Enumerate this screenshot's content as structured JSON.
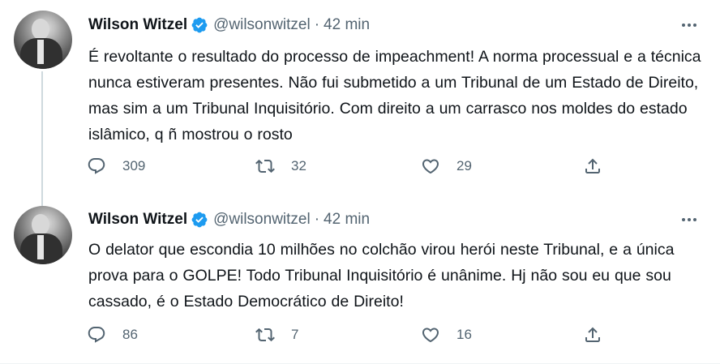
{
  "tweets": [
    {
      "author_name": "Wilson Witzel",
      "handle": "@wilsonwitzel",
      "separator": "·",
      "time": "42 min",
      "text": "É revoltante o resultado do processo de impeachment! A norma processual e a técnica nunca estiveram presentes. Não fui submetido a um Tribunal de um Estado de Direito, mas sim a um Tribunal Inquisitório. Com direito a um carrasco nos moldes do estado islâmico, q ñ mostrou o rosto",
      "replies": "309",
      "retweets": "32",
      "likes": "29"
    },
    {
      "author_name": "Wilson Witzel",
      "handle": "@wilsonwitzel",
      "separator": "·",
      "time": "42 min",
      "text": "O delator que escondia 10 milhões no colchão virou herói neste Tribunal, e a única prova para o GOLPE! Todo Tribunal Inquisitório é unânime. Hj não sou eu que sou cassado, é o Estado Democrático de Direito!",
      "replies": "86",
      "retweets": "7",
      "likes": "16"
    }
  ],
  "icons": {
    "verified": "verified-badge-icon",
    "more": "more-icon",
    "reply": "reply-icon",
    "retweet": "retweet-icon",
    "like": "like-icon",
    "share": "share-icon"
  },
  "colors": {
    "text": "#0f1419",
    "secondary": "#536471",
    "verified": "#1d9bf0",
    "thread_line": "#cfd9de"
  }
}
